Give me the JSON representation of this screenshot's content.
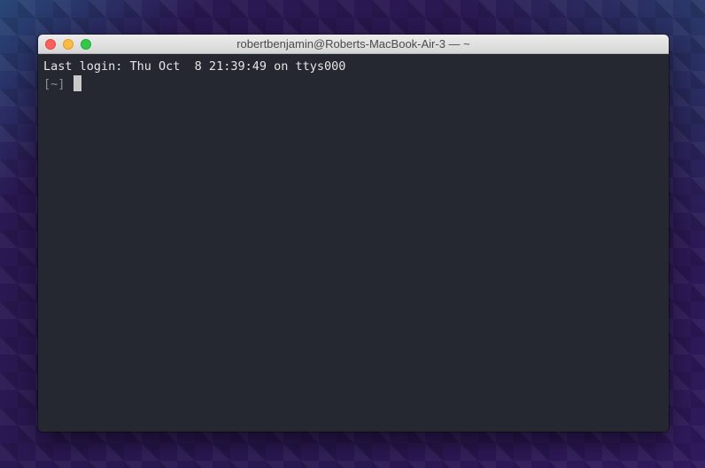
{
  "window": {
    "title": "robertbenjamin@Roberts-MacBook-Air-3 — ~"
  },
  "terminal": {
    "last_login": "Last login: Thu Oct  8 21:39:49 on ttys000",
    "prompt": "[~]"
  },
  "colors": {
    "terminal_bg": "#262831",
    "close": "#fc605c",
    "minimize": "#fdbc40",
    "zoom": "#34c84a"
  },
  "icons": {
    "close": "close-icon",
    "minimize": "minimize-icon",
    "zoom": "zoom-icon"
  }
}
